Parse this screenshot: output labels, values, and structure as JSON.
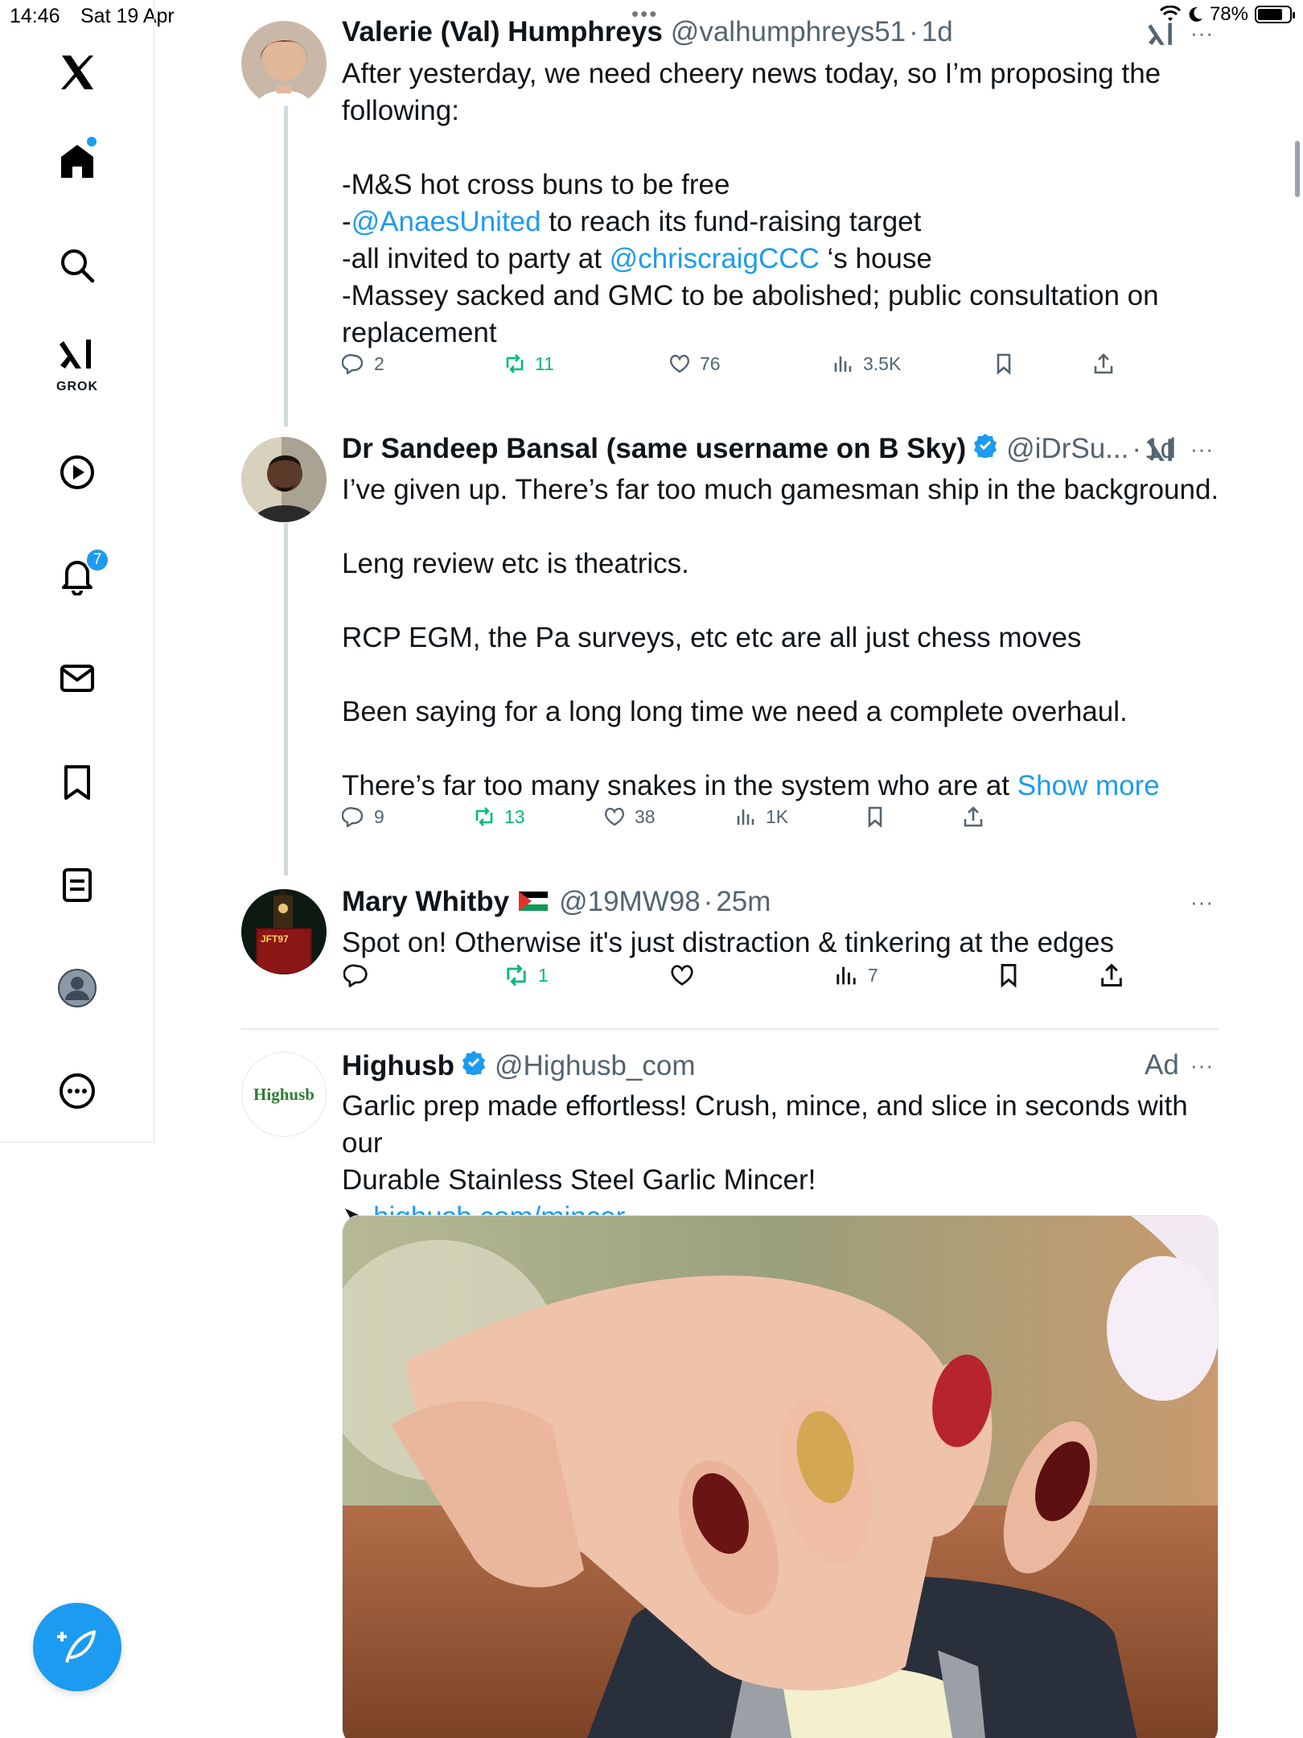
{
  "status_bar": {
    "time": "14:46",
    "date": "Sat 19 Apr",
    "battery": "78%",
    "battery_level": 0.78,
    "multitask_dots": "•••"
  },
  "sidebar": {
    "logo": "x-logo-icon",
    "items": [
      {
        "name": "home",
        "icon": "home-icon",
        "has_dot": true
      },
      {
        "name": "explore",
        "icon": "search-icon"
      },
      {
        "name": "grok",
        "icon": "grok-icon",
        "label": "GROK"
      },
      {
        "name": "videos",
        "icon": "play-icon"
      },
      {
        "name": "notifications",
        "icon": "bell-icon",
        "badge": "7"
      },
      {
        "name": "messages",
        "icon": "mail-icon"
      },
      {
        "name": "bookmarks",
        "icon": "bookmark-icon"
      },
      {
        "name": "lists",
        "icon": "list-icon"
      },
      {
        "name": "profile",
        "icon": "avatar-icon"
      },
      {
        "name": "more",
        "icon": "more-circle-icon"
      }
    ],
    "compose_icon": "compose-post-icon"
  },
  "tweets": [
    {
      "name": "Valerie (Val) Humphreys",
      "handle": "@valhumphreys51",
      "sep": "·",
      "time": "1d",
      "more": "···",
      "text_lines": [
        {
          "parts": [
            {
              "t": "After yesterday, we need cheery news today, so I’m proposing the"
            }
          ]
        },
        {
          "parts": [
            {
              "t": "following:"
            }
          ]
        },
        {
          "parts": []
        },
        {
          "parts": [
            {
              "t": "-M&S hot cross buns to be free"
            }
          ]
        },
        {
          "parts": [
            {
              "t": "-"
            },
            {
              "t": "@AnaesUnited",
              "link": true
            },
            {
              "t": " to reach its fund-raising target"
            }
          ]
        },
        {
          "parts": [
            {
              "t": "-all invited to party at "
            },
            {
              "t": "@chriscraigCCC",
              "link": true
            },
            {
              "t": " ‘s house"
            }
          ]
        },
        {
          "parts": [
            {
              "t": "-Massey sacked and GMC to be abolished; public consultation on"
            }
          ]
        },
        {
          "parts": [
            {
              "t": "replacement"
            }
          ]
        }
      ],
      "replies": "2",
      "reposts": "11",
      "likes": "76",
      "views": "3.5K"
    },
    {
      "name": "Dr Sandeep Bansal (same username on B Sky)",
      "handle": "@iDrSu...",
      "sep": "·",
      "time": "1d",
      "more": "···",
      "text_lines": [
        {
          "parts": [
            {
              "t": "I’ve given up. There’s far too much gamesman ship in the background."
            }
          ]
        },
        {
          "parts": []
        },
        {
          "parts": [
            {
              "t": "Leng review etc is theatrics."
            }
          ]
        },
        {
          "parts": []
        },
        {
          "parts": [
            {
              "t": "RCP EGM, the Pa surveys, etc etc are all just chess moves"
            }
          ]
        },
        {
          "parts": []
        },
        {
          "parts": [
            {
              "t": "Been saying for a long long time we need a complete overhaul."
            }
          ]
        },
        {
          "parts": []
        },
        {
          "parts": [
            {
              "t": "There’s far too many snakes in the system who are at "
            },
            {
              "t": "Show more",
              "link": true
            }
          ]
        }
      ],
      "replies": "9",
      "reposts": "13",
      "likes": "38",
      "views": "1K"
    },
    {
      "name": "Mary Whitby",
      "flag": "palestine-flag-icon",
      "handle": "@19MW98",
      "sep": "·",
      "time": "25m",
      "more": "···",
      "avatar_text": "JFT97",
      "text_lines": [
        {
          "parts": [
            {
              "t": "Spot on! Otherwise it's just distraction & tinkering at the edges"
            }
          ]
        }
      ],
      "replies": "",
      "reposts": "1",
      "likes": "",
      "views": "7"
    }
  ],
  "ad": {
    "name": "Highusb",
    "handle": "@Highusb_com",
    "ad_label": "Ad",
    "more": "···",
    "avatar_text": "Highusb",
    "text_lines": [
      {
        "parts": [
          {
            "t": "Garlic prep made effortless! Crush, mince, and slice in seconds with our"
          }
        ]
      },
      {
        "parts": [
          {
            "t": "Durable Stainless Steel Garlic Mincer!"
          }
        ]
      },
      {
        "parts": [
          {
            "t": "➤ "
          },
          {
            "t": "highusb.com/mincer",
            "link": true
          }
        ]
      }
    ],
    "media": "garlic-press-hand-image"
  },
  "colors": {
    "accent": "#1d9bf0",
    "repost": "#00ba7c",
    "muted": "#536471",
    "text": "#0f1419"
  }
}
